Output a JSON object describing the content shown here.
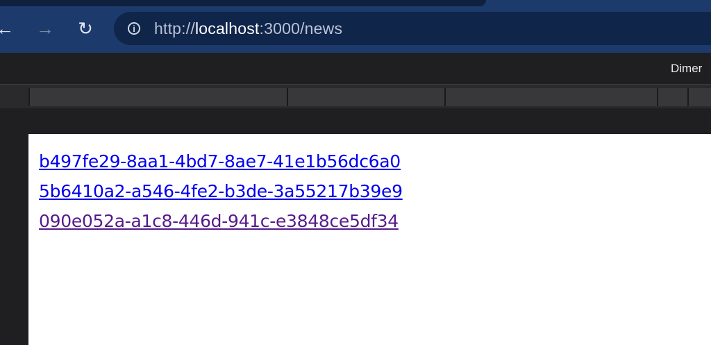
{
  "browser": {
    "nav": {
      "back_icon": "←",
      "forward_icon": "→",
      "reload_icon": "↻"
    },
    "address": {
      "scheme": "http://",
      "host": "localhost",
      "rest": ":3000/news"
    }
  },
  "devtools": {
    "dimensions_label": "Dimer"
  },
  "page": {
    "links": [
      {
        "text": "b497fe29-8aa1-4bd7-8ae7-41e1b56dc6a0",
        "visited": false
      },
      {
        "text": "5b6410a2-a546-4fe2-b3de-3a55217b39e9",
        "visited": false
      },
      {
        "text": "090e052a-a1c8-446d-941c-e3848ce5df34",
        "visited": true
      }
    ]
  }
}
